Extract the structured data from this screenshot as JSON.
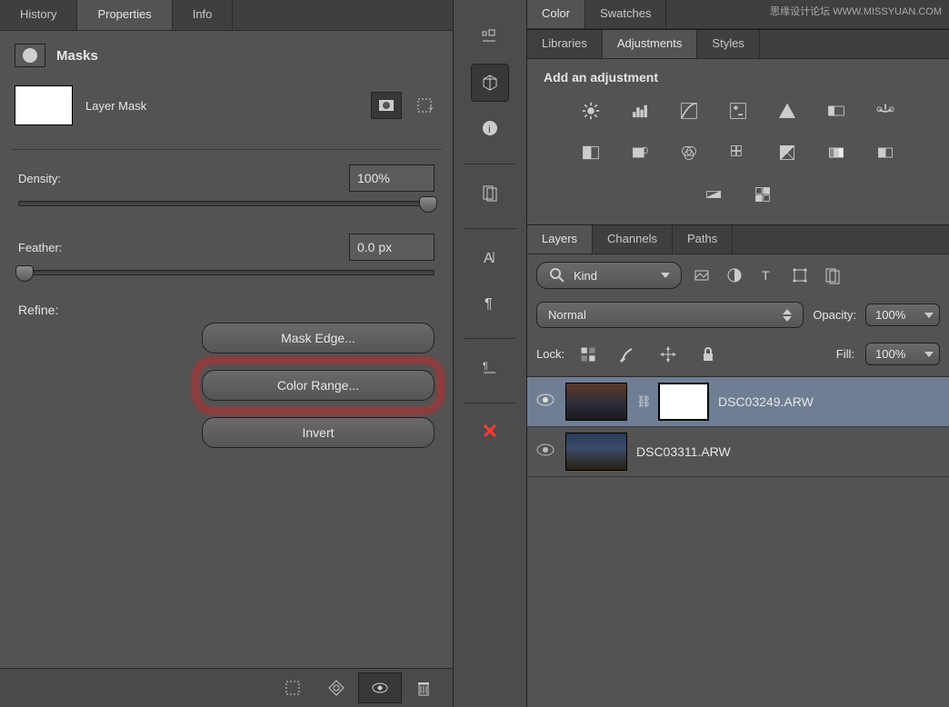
{
  "watermark": "思缘设计论坛  WWW.MISSYUAN.COM",
  "left": {
    "tabs": {
      "history": "History",
      "properties": "Properties",
      "info": "Info"
    },
    "masks_title": "Masks",
    "layer_mask_label": "Layer Mask",
    "density": {
      "label": "Density:",
      "value": "100%"
    },
    "feather": {
      "label": "Feather:",
      "value": "0.0 px"
    },
    "refine": {
      "label": "Refine:",
      "mask_edge": "Mask Edge...",
      "color_range": "Color Range...",
      "invert": "Invert"
    }
  },
  "right": {
    "color_tabs": {
      "color": "Color",
      "swatches": "Swatches"
    },
    "lib_tabs": {
      "libraries": "Libraries",
      "adjustments": "Adjustments",
      "styles": "Styles"
    },
    "adj_header": "Add an adjustment",
    "layers_tabs": {
      "layers": "Layers",
      "channels": "Channels",
      "paths": "Paths"
    },
    "kind_label": "Kind",
    "blend_mode": "Normal",
    "opacity_label": "Opacity:",
    "opacity_value": "100%",
    "lock_label": "Lock:",
    "fill_label": "Fill:",
    "fill_value": "100%",
    "layers": [
      {
        "name": "DSC03249.ARW"
      },
      {
        "name": "DSC03311.ARW"
      }
    ]
  }
}
